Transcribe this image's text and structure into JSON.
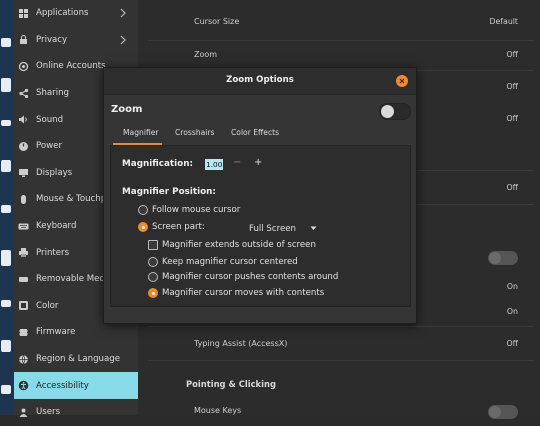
{
  "sidebar": {
    "items": [
      {
        "label": "Applications",
        "icon": "applications-icon",
        "chevron": true
      },
      {
        "label": "Privacy",
        "icon": "privacy-icon",
        "chevron": true
      },
      {
        "label": "Online Accounts",
        "icon": "online-accounts-icon"
      },
      {
        "label": "Sharing",
        "icon": "sharing-icon"
      },
      {
        "label": "Sound",
        "icon": "sound-icon"
      },
      {
        "label": "Power",
        "icon": "power-icon"
      },
      {
        "label": "Displays",
        "icon": "displays-icon"
      },
      {
        "label": "Mouse & Touchpad",
        "icon": "mouse-icon"
      },
      {
        "label": "Keyboard",
        "icon": "keyboard-icon"
      },
      {
        "label": "Printers",
        "icon": "printer-icon"
      },
      {
        "label": "Removable Media",
        "icon": "removable-media-icon"
      },
      {
        "label": "Color",
        "icon": "color-icon"
      },
      {
        "label": "Firmware",
        "icon": "firmware-icon"
      },
      {
        "label": "Region & Language",
        "icon": "region-icon"
      },
      {
        "label": "Accessibility",
        "icon": "accessibility-icon",
        "selected": true
      },
      {
        "label": "Users",
        "icon": "users-icon"
      }
    ]
  },
  "background": {
    "rows": [
      {
        "label": "Cursor Size",
        "value": "Default"
      },
      {
        "label": "Zoom",
        "value": "Off"
      },
      {
        "label": "",
        "value": "Off"
      },
      {
        "label": "",
        "value": "Off"
      },
      {
        "label": "",
        "value": "Off"
      },
      {
        "label": "",
        "value": "On"
      },
      {
        "label": "",
        "value": "On"
      },
      {
        "label": "Typing Assist (AccessX)",
        "value": "Off"
      }
    ],
    "section_pointing": "Pointing & Clicking",
    "mouse_keys": "Mouse Keys"
  },
  "dialog": {
    "title": "Zoom Options",
    "zoom_label": "Zoom",
    "zoom_on": false,
    "tabs": [
      "Magnifier",
      "Crosshairs",
      "Color Effects"
    ],
    "active_tab": 0,
    "magnification_label": "Magnification:",
    "magnification_value": "1.00",
    "minus": "−",
    "plus": "+",
    "position_label": "Magnifier Position:",
    "follow_mouse": "Follow mouse cursor",
    "screen_part": "Screen part:",
    "screen_part_value": "Full Screen",
    "extends_outside": "Magnifier extends outside of screen",
    "keep_centered": "Keep magnifier cursor centered",
    "pushes_contents": "Magnifier cursor pushes contents around",
    "moves_with": "Magnifier cursor moves with contents",
    "accent": "#f08a24"
  }
}
